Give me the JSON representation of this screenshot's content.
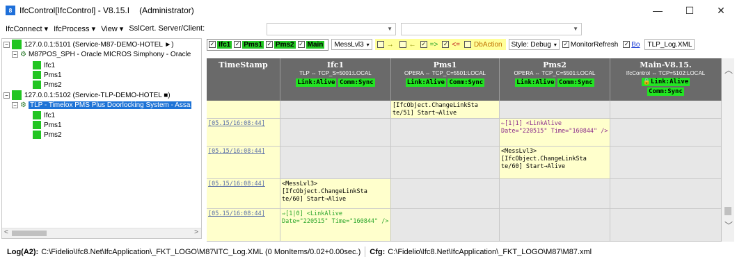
{
  "window": {
    "title": "IfcControl[IfcControl] - V8.15.I",
    "admin": "(Administrator)",
    "minimize": "—",
    "maximize": "☐",
    "close": "✕"
  },
  "menu": {
    "items": [
      "IfcConnect ▾",
      "IfcProcess ▾",
      "View ▾",
      "SslCert. Server/Client:"
    ]
  },
  "tree": {
    "nodes": [
      {
        "label": "127.0.0.1:5101 (Service-M87-DEMO-HOTEL ►)"
      },
      {
        "label": "M87POS_SPH - Oracle MICROS Simphony - Oracle"
      },
      {
        "label": "Ifc1"
      },
      {
        "label": "Pms1"
      },
      {
        "label": "Pms2"
      },
      {
        "label": "127.0.0.1:5102 (Service-TLP-DEMO-HOTEL ■)"
      },
      {
        "label": "TLP - Timelox PMS Plus Doorlocking System - Assa"
      },
      {
        "label": "Ifc1"
      },
      {
        "label": "Pms1"
      },
      {
        "label": "Pms2"
      }
    ]
  },
  "toolbar": {
    "checks": [
      "Ifc1",
      "Pms1",
      "Pms2",
      "Main"
    ],
    "mess_level": "MessLvl3",
    "arrow_right": "→",
    "arrow_left": "←",
    "arrow_both": "=>",
    "arrow_back": "<=",
    "db_action": "DbAction",
    "style": "Style: Debug",
    "monitor_refresh": "MonitorRefresh",
    "bo": "Bo",
    "tlp_log": "TLP_Log.XML"
  },
  "grid": {
    "headers": [
      {
        "title": "TimeStamp",
        "sub": "",
        "tags": []
      },
      {
        "title": "Ifc1",
        "sub": "TLP ⇔ TCP_S=5001:LOCAL",
        "tags": [
          "Link:Alive",
          "Comm:Sync"
        ]
      },
      {
        "title": "Pms1",
        "sub": "OPERA ⇔ TCP_C=5501:LOCAL",
        "tags": [
          "Link:Alive",
          "Comm:Sync"
        ]
      },
      {
        "title": "Pms2",
        "sub": "OPERA ⇔ TCP_C=5501:LOCAL",
        "tags": [
          "Link:Alive",
          "Comm:Sync"
        ]
      },
      {
        "title": "Main-V8.15.",
        "sub": "IfcControl ⇔ TCP=5102:LOCAL",
        "tags": [
          "🔒Link:Alive",
          "Comm:Sync"
        ]
      }
    ],
    "rows": [
      {
        "ts": "",
        "ifc1": "",
        "pms1": "[IfcObject.ChangeLinkSta te/51] Start→Alive",
        "pms2": "",
        "main": ""
      },
      {
        "ts": "[05.15/16:08:44]",
        "ifc1": "",
        "pms1": "",
        "pms2": "⇐[1|1] <LinkAlive Date=\"220515\" Time=\"160844\" />",
        "main": ""
      },
      {
        "ts": "[05.15/16:08:44]",
        "ifc1": "",
        "pms1": "",
        "pms2": "<MessLvl3> [IfcObject.ChangeLinkSta te/60] Start→Alive",
        "main": ""
      },
      {
        "ts": "[05.15/16:08:44]",
        "ifc1": "<MessLvl3> [IfcObject.ChangeLinkSta te/60] Start→Alive",
        "pms1": "",
        "pms2": "",
        "main": ""
      },
      {
        "ts": "[05.15/16:08:44]",
        "ifc1": "⇒[1|0] <LinkAlive Date=\"220515\" Time=\"160844\" />",
        "pms1": "",
        "pms2": "",
        "main": ""
      }
    ]
  },
  "status": {
    "log_label": "Log(A2):",
    "log_value": "C:\\Fidelio\\Ifc8.Net\\IfcApplication\\_FKT_LOGO\\M87\\ITC_Log.XML (0 MonItems/0.02+0.00sec.)",
    "cfg_label": "Cfg:",
    "cfg_value": "C:\\Fidelio\\Ifc8.Net\\IfcApplication\\_FKT_LOGO\\M87\\M87.xml"
  }
}
